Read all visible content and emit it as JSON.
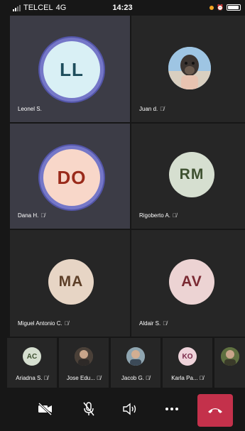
{
  "status_bar": {
    "carrier": "TELCEL",
    "network": "4G",
    "time": "14:23"
  },
  "participants": [
    {
      "name": "Leonel S.",
      "initials": "LL",
      "avatar_bg": "#d9f0f5",
      "avatar_fg": "#1e4d5c",
      "speaking": true,
      "muted": false
    },
    {
      "name": "Juan d.",
      "initials": "",
      "avatar_photo": true,
      "muted": true
    },
    {
      "name": "Dana H.",
      "initials": "DO",
      "avatar_bg": "#f8d7c9",
      "avatar_fg": "#9a2a1a",
      "speaking": true,
      "muted": true
    },
    {
      "name": "Rigoberto A.",
      "initials": "RM",
      "avatar_bg": "#d6dfd0",
      "avatar_fg": "#3e5130",
      "muted": true
    },
    {
      "name": "Miguel Antonio C.",
      "initials": "MA",
      "avatar_bg": "#e7d5c5",
      "avatar_fg": "#5d3f28",
      "muted": true
    },
    {
      "name": "Aldair S.",
      "initials": "AV",
      "avatar_bg": "#ecd3d3",
      "avatar_fg": "#7a2a33",
      "muted": true
    }
  ],
  "strip": [
    {
      "name": "Ariadna S.",
      "initials": "AC",
      "avatar_bg": "#d6dfd0",
      "avatar_fg": "#3e5130",
      "muted": true
    },
    {
      "name": "Jose Edu...",
      "initials": "",
      "avatar_photo": true,
      "muted": true
    },
    {
      "name": "Jacob G.",
      "initials": "",
      "avatar_photo": true,
      "muted": true
    },
    {
      "name": "Karla Pa...",
      "initials": "KO",
      "avatar_bg": "#eed3da",
      "avatar_fg": "#7a2a4a",
      "muted": true
    },
    {
      "name": "",
      "initials": "",
      "avatar_photo": true,
      "muted": false
    }
  ],
  "controls": {
    "camera": "camera-off-icon",
    "mic": "mic-off-icon",
    "speaker": "speaker-icon",
    "more": "more-icon",
    "hangup": "hang-up-icon",
    "hangup_color": "#c4314b"
  }
}
